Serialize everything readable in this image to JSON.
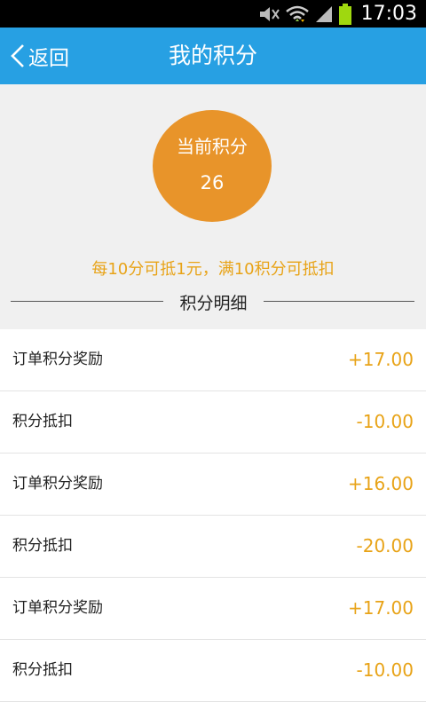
{
  "status_bar": {
    "time": "17:03",
    "icons": [
      "mute-icon",
      "wifi-icon",
      "signal-icon",
      "battery-icon"
    ]
  },
  "nav": {
    "back_label": "返回",
    "title": "我的积分"
  },
  "points": {
    "label": "当前积分",
    "value": "26"
  },
  "rule_text": "每10分可抵1元，满10积分可抵扣",
  "detail_title": "积分明细",
  "records": [
    {
      "label": "订单积分奖励",
      "amount": "+17.00"
    },
    {
      "label": "积分抵扣",
      "amount": "-10.00"
    },
    {
      "label": "订单积分奖励",
      "amount": "+16.00"
    },
    {
      "label": "积分抵扣",
      "amount": "-20.00"
    },
    {
      "label": "订单积分奖励",
      "amount": "+17.00"
    },
    {
      "label": "积分抵扣",
      "amount": "-10.00"
    }
  ],
  "colors": {
    "nav_bg": "#27a0e3",
    "accent": "#e8942a",
    "amount": "#e8a317",
    "summary_bg": "#f0f0f0"
  }
}
